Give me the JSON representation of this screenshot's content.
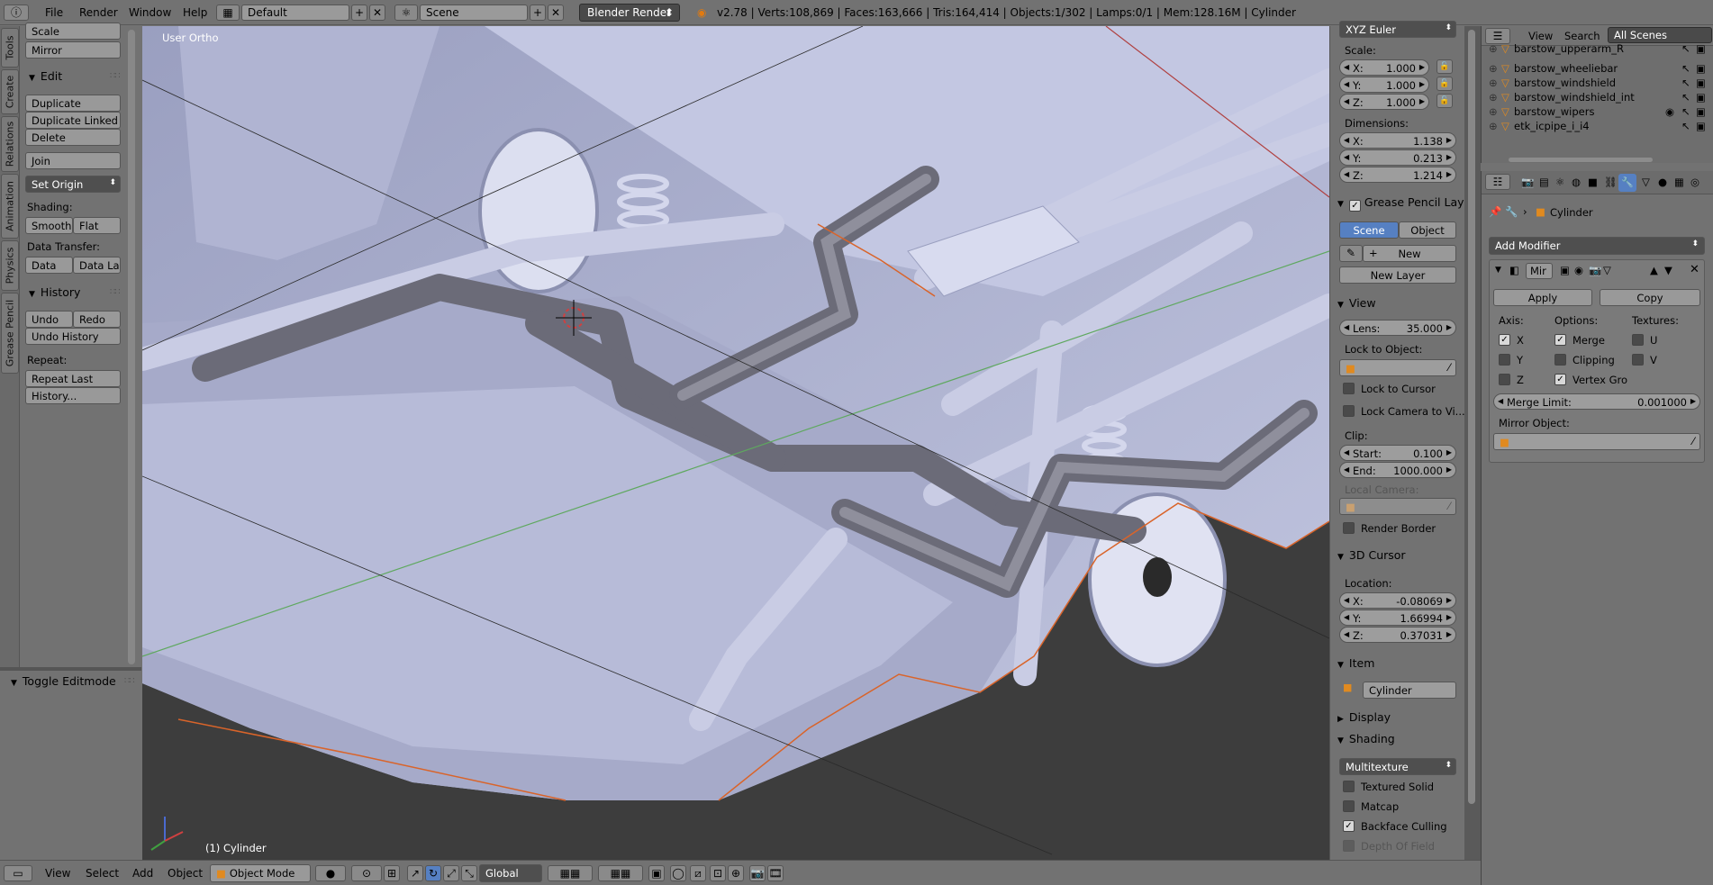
{
  "topbar": {
    "menus": [
      "File",
      "Render",
      "Window",
      "Help"
    ],
    "screen_layout": "Default",
    "scene": "Scene",
    "render_engine": "Blender Render",
    "stats": "v2.78 | Verts:108,869 | Faces:163,666 | Tris:164,414 | Objects:1/302 | Lamps:0/1 | Mem:128.16M | Cylinder"
  },
  "left_tabs": [
    "Tools",
    "Create",
    "Relations",
    "Animation",
    "Physics",
    "Grease Pencil"
  ],
  "toolshelf": {
    "scale": "Scale",
    "mirror": "Mirror",
    "edit_header": "Edit",
    "duplicate": "Duplicate",
    "duplicate_linked": "Duplicate Linked",
    "delete": "Delete",
    "join": "Join",
    "set_origin": "Set Origin",
    "shading_label": "Shading:",
    "smooth": "Smooth",
    "flat": "Flat",
    "data_transfer_label": "Data Transfer:",
    "data": "Data",
    "data_la": "Data La",
    "history_header": "History",
    "undo": "Undo",
    "redo": "Redo",
    "undo_history": "Undo History",
    "repeat_label": "Repeat:",
    "repeat_last": "Repeat Last",
    "history_btn": "History...",
    "toggle_editmode": "Toggle Editmode"
  },
  "viewport": {
    "view_label": "User Ortho",
    "object_label": "(1) Cylinder"
  },
  "npanel": {
    "rotation_mode": "XYZ Euler",
    "scale_label": "Scale:",
    "scale": [
      {
        "k": "X:",
        "v": "1.000"
      },
      {
        "k": "Y:",
        "v": "1.000"
      },
      {
        "k": "Z:",
        "v": "1.000"
      }
    ],
    "dimensions_label": "Dimensions:",
    "dimensions": [
      {
        "k": "X:",
        "v": "1.138"
      },
      {
        "k": "Y:",
        "v": "0.213"
      },
      {
        "k": "Z:",
        "v": "1.214"
      }
    ],
    "grease_pencil_header": "Grease Pencil Laye",
    "scene_btn": "Scene",
    "object_btn": "Object",
    "new_btn": "New",
    "new_layer_btn": "New Layer",
    "view_header": "View",
    "lens_label": "Lens:",
    "lens_value": "35.000",
    "lock_to_object_label": "Lock to Object:",
    "lock_to_cursor": "Lock to Cursor",
    "lock_camera": "Lock Camera to Vi...",
    "clip_label": "Clip:",
    "clip_start_label": "Start:",
    "clip_start": "0.100",
    "clip_end_label": "End:",
    "clip_end": "1000.000",
    "local_camera_label": "Local Camera:",
    "render_border": "Render Border",
    "cursor_header": "3D Cursor",
    "location_label": "Location:",
    "cursor": [
      {
        "k": "X:",
        "v": "-0.08069"
      },
      {
        "k": "Y:",
        "v": "1.66994"
      },
      {
        "k": "Z:",
        "v": "0.37031"
      }
    ],
    "item_header": "Item",
    "item_name": "Cylinder",
    "display_header": "Display",
    "shading_header": "Shading",
    "shading_mode": "Multitexture",
    "textured_solid": "Textured Solid",
    "matcap": "Matcap",
    "backface_culling": "Backface Culling",
    "depth_of_field": "Depth Of Field"
  },
  "outliner": {
    "view": "View",
    "search": "Search",
    "scenes": "All Scenes",
    "items": [
      "barstow_upperarm_R",
      "barstow_wheeliebar",
      "barstow_windshield",
      "barstow_windshield_int",
      "barstow_wipers",
      "etk_icpipe_i_i4"
    ]
  },
  "properties": {
    "breadcrumb": "Cylinder",
    "add_modifier": "Add Modifier",
    "modifier_name": "Mir",
    "apply": "Apply",
    "copy": "Copy",
    "axis_label": "Axis:",
    "options_label": "Options:",
    "textures_label": "Textures:",
    "x": "X",
    "y": "Y",
    "z": "Z",
    "merge": "Merge",
    "clipping": "Clipping",
    "vertex_groups": "Vertex Gro",
    "u": "U",
    "v": "V",
    "merge_limit_label": "Merge Limit:",
    "merge_limit": "0.001000",
    "mirror_object_label": "Mirror Object:"
  },
  "bottombar": {
    "menus": [
      "View",
      "Select",
      "Add",
      "Object"
    ],
    "mode": "Object Mode",
    "orientation": "Global"
  },
  "colors": {
    "background": "#727272",
    "selected_blue": "#5680c2",
    "viewport_floor": "#3d3d3d",
    "mesh": "#b9bdd8"
  }
}
